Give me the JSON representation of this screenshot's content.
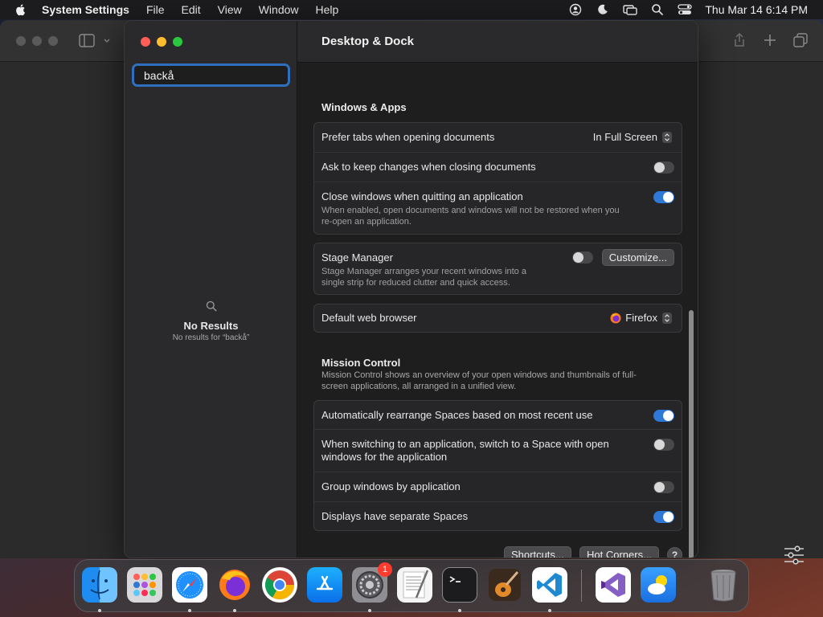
{
  "menubar": {
    "app_name": "System Settings",
    "items": [
      "File",
      "Edit",
      "View",
      "Window",
      "Help"
    ],
    "clock": "Thu Mar 14  6:14 PM"
  },
  "sidebar": {
    "search_value": "backå",
    "no_results_title": "No Results",
    "no_results_sub": "No results for “backå”"
  },
  "header": {
    "title": "Desktop & Dock"
  },
  "windows_apps": {
    "title": "Windows & Apps",
    "prefer_tabs": {
      "label": "Prefer tabs when opening documents",
      "value": "In Full Screen"
    },
    "ask_keep_changes": {
      "label": "Ask to keep changes when closing documents",
      "on": false
    },
    "close_windows": {
      "label": "Close windows when quitting an application",
      "desc_line1": "When enabled, open documents and windows will not be restored when you",
      "desc_line2": "re-open an application.",
      "on": true
    }
  },
  "stage_manager": {
    "label": "Stage Manager",
    "desc_line1": "Stage Manager arranges your recent windows into a",
    "desc_line2": "single strip for reduced clutter and quick access.",
    "on": false,
    "customize_label": "Customize..."
  },
  "browser": {
    "label": "Default web browser",
    "value": "Firefox"
  },
  "mission_control": {
    "title": "Mission Control",
    "desc_line1": "Mission Control shows an overview of your open windows and thumbnails of full-",
    "desc_line2": "screen applications, all arranged in a unified view.",
    "auto_rearrange": {
      "label": "Automatically rearrange Spaces based on most recent use",
      "on": true
    },
    "switch_space": {
      "label_line1": "When switching to an application, switch to a Space with open",
      "label_line2": "windows for the application",
      "on": false
    },
    "group_windows": {
      "label": "Group windows by application",
      "on": false
    },
    "separate_spaces": {
      "label": "Displays have separate Spaces",
      "on": true
    }
  },
  "footer": {
    "shortcuts_label": "Shortcuts...",
    "hot_corners_label": "Hot Corners...",
    "help_label": "?"
  },
  "dock": {
    "badge_count": "1",
    "items": [
      "finder-icon",
      "launchpad-icon",
      "safari-icon",
      "firefox-icon",
      "chrome-icon",
      "app-store-icon",
      "system-settings-icon",
      "textedit-icon",
      "terminal-icon",
      "garageband-icon",
      "vscode-icon",
      "visual-studio-icon",
      "weather-icon",
      "trash-icon"
    ]
  },
  "colors": {
    "accent": "#2f78d6",
    "search_focus": "#2f6fbd"
  }
}
